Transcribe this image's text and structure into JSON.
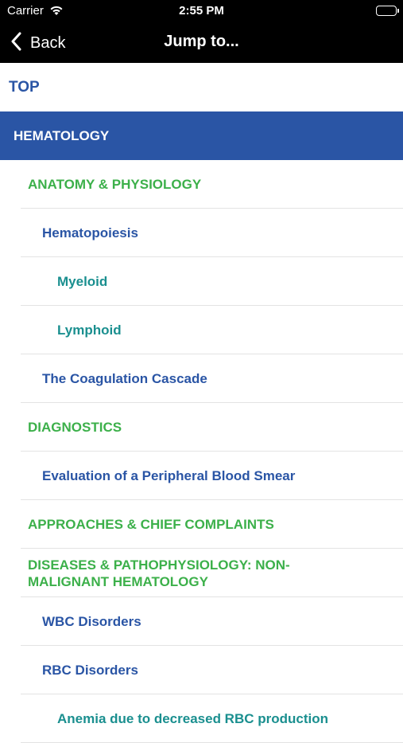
{
  "status_bar": {
    "carrier": "Carrier",
    "time": "2:55 PM"
  },
  "nav": {
    "back_label": "Back",
    "title": "Jump to..."
  },
  "list": {
    "top": "TOP",
    "section": "HEMATOLOGY",
    "items": [
      {
        "label": "ANATOMY & PHYSIOLOGY",
        "level": 1
      },
      {
        "label": "Hematopoiesis",
        "level": 2
      },
      {
        "label": "Myeloid",
        "level": 3
      },
      {
        "label": "Lymphoid",
        "level": 3
      },
      {
        "label": "The Coagulation Cascade",
        "level": 2
      },
      {
        "label": "DIAGNOSTICS",
        "level": 1
      },
      {
        "label": "Evaluation of a Peripheral Blood Smear",
        "level": 2
      },
      {
        "label": "APPROACHES & CHIEF COMPLAINTS",
        "level": 1
      },
      {
        "label": "DISEASES & PATHOPHYSIOLOGY: NON-MALIGNANT HEMATOLOGY",
        "level": 1
      },
      {
        "label": "WBC Disorders",
        "level": 2
      },
      {
        "label": "RBC Disorders",
        "level": 2
      },
      {
        "label": "Anemia due to decreased RBC production",
        "level": 3
      }
    ]
  },
  "colors": {
    "header_bg": "#000000",
    "section_bg": "#2a55a5",
    "level1": "#3cb04a",
    "level2": "#2a55a5",
    "level3": "#1a8f8f"
  }
}
